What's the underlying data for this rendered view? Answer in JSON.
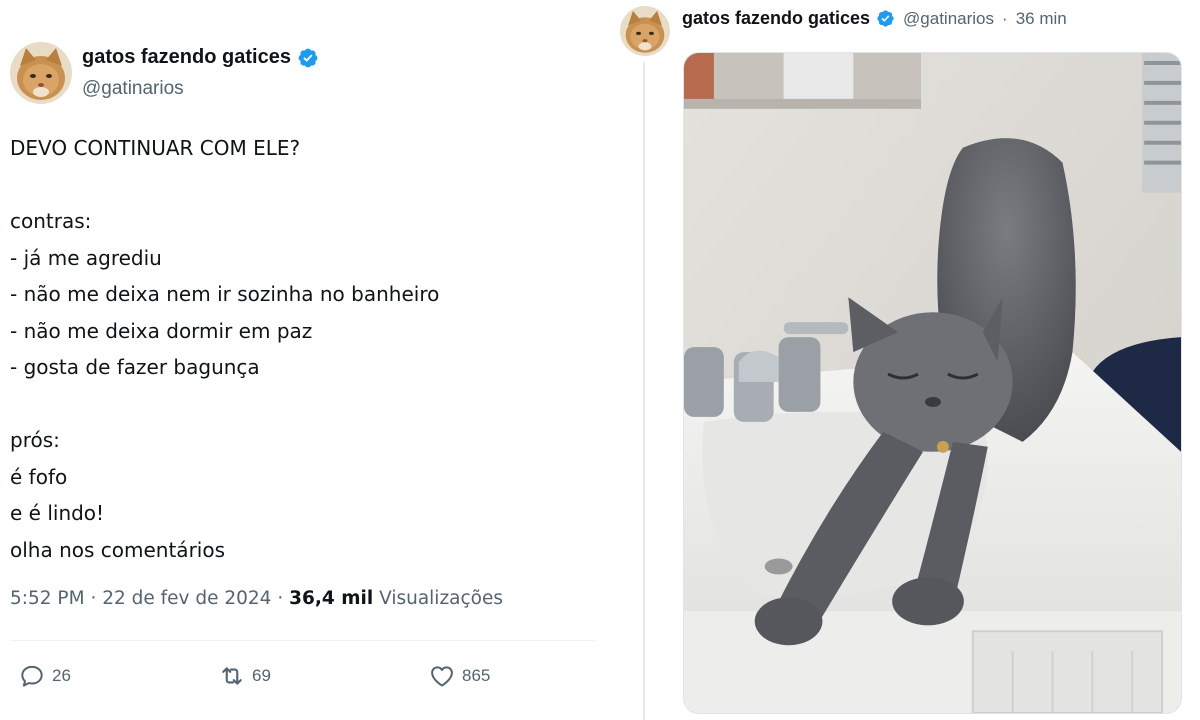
{
  "left_tweet": {
    "display_name": "gatos fazendo gatices",
    "handle": "@gatinarios",
    "verified_icon": "verified-badge-icon",
    "lines": [
      "DEVO CONTINUAR COM ELE?",
      "",
      "contras:",
      "- já me agrediu",
      "- não me deixa nem ir sozinha no banheiro",
      "- não me deixa dormir em paz",
      "- gosta de fazer bagunça",
      "",
      "prós:",
      "é fofo",
      "e é lindo!",
      "olha nos comentários"
    ],
    "time": "5:52 PM",
    "date": "22 de fev de 2024",
    "views_count": "36,4 mil",
    "views_label": "Visualizações",
    "separator": "·",
    "actions": {
      "reply": {
        "icon": "reply-icon",
        "count": "26"
      },
      "retweet": {
        "icon": "retweet-icon",
        "count": "69"
      },
      "like": {
        "icon": "heart-icon",
        "count": "865"
      }
    }
  },
  "right_tweet": {
    "display_name": "gatos fazendo gatices",
    "handle": "@gatinarios",
    "separator": "·",
    "time_ago": "36 min",
    "photo": "gray cat stretching on bathroom sink"
  },
  "colors": {
    "text": "#0f1419",
    "secondary": "#536471",
    "verified_blue": "#1d9bf0",
    "divider": "#eff3f4"
  }
}
